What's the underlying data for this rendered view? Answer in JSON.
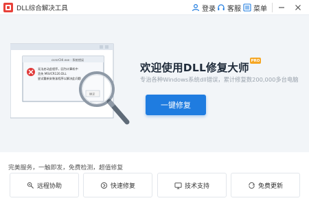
{
  "app": {
    "title": "DLL综合解决工具"
  },
  "titlebar": {
    "login_label": "登录",
    "service_label": "客服",
    "menu_label": "菜单"
  },
  "hero": {
    "headline": "欢迎使用DLL修复大师",
    "badge": "PRO",
    "subtitle": "专治各种Windows系统dll错误，累计修复数200,000多台电脑",
    "repair_button": "一键修复"
  },
  "illustration": {
    "dialog_title": "csrsrCHI.exe - 系统错误",
    "message_lines": [
      "无法启动此程序，因为计算机中",
      "丢失 MSVCR120.DLL",
      "尝试重新安装该程序以解决此问题"
    ],
    "ok_label": "确定"
  },
  "features": {
    "label": "完美服务，一触即发，免费检测，超值修复",
    "cards": [
      {
        "label": "远程协助",
        "icon": "remote-assist-icon"
      },
      {
        "label": "快速修复",
        "icon": "quick-repair-icon"
      },
      {
        "label": "技术支持",
        "icon": "tech-support-icon"
      },
      {
        "label": "免费更新",
        "icon": "free-update-icon"
      }
    ]
  },
  "colors": {
    "accent": "#1f7ce0",
    "hero_bg": "#f2f5f8",
    "badge": "#f5a623",
    "error_red": "#e03a3a"
  }
}
